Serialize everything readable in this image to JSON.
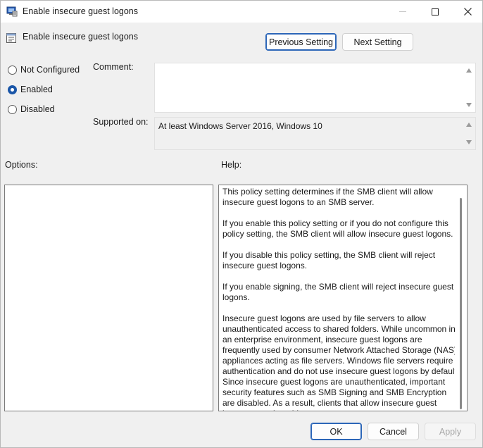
{
  "window": {
    "title": "Enable insecure guest logons"
  },
  "header": {
    "title": "Enable insecure guest logons",
    "prev_label": "Previous Setting",
    "next_label": "Next Setting"
  },
  "state": {
    "options": [
      {
        "label": "Not Configured",
        "checked": false
      },
      {
        "label": "Enabled",
        "checked": true
      },
      {
        "label": "Disabled",
        "checked": false
      }
    ]
  },
  "comment": {
    "label": "Comment:",
    "value": ""
  },
  "supported": {
    "label": "Supported on:",
    "value": "At least Windows Server 2016, Windows 10"
  },
  "options_section": {
    "label": "Options:"
  },
  "help_section": {
    "label": "Help:",
    "paragraphs": [
      "This policy setting determines if the SMB client will allow insecure guest logons to an SMB server.",
      "If you enable this policy setting or if you do not configure this policy setting, the SMB client will allow insecure guest logons.",
      "If you disable this policy setting, the SMB client will reject insecure guest logons.",
      "If you enable signing, the SMB client will reject insecure guest logons.",
      "Insecure guest logons are used by file servers to allow unauthenticated access to shared folders. While uncommon in an enterprise environment, insecure guest logons are frequently used by consumer Network Attached Storage (NAS) appliances acting as file servers. Windows file servers require authentication and do not use insecure guest logons by default. Since insecure guest logons are unauthenticated, important security features such as SMB Signing and SMB Encryption are disabled. As a result, clients that allow insecure guest logons are vulnerable to a"
    ]
  },
  "footer": {
    "ok_label": "OK",
    "cancel_label": "Cancel",
    "apply_label": "Apply"
  },
  "colors": {
    "accent": "#1a56a8",
    "window_bg": "#f0f0f0"
  }
}
